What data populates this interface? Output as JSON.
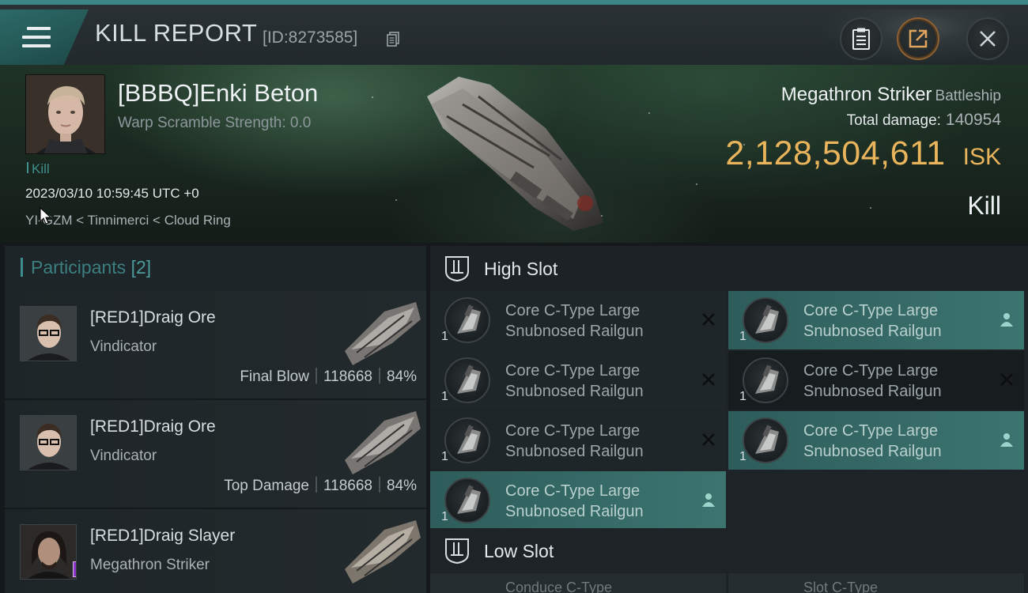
{
  "header": {
    "title": "KILL REPORT",
    "report_id": "[ID:8273585]",
    "icons": [
      "menu-icon",
      "copy-icon",
      "clipboard-icon",
      "share-icon",
      "close-icon"
    ]
  },
  "victim": {
    "name": "[BBBQ]Enki Beton",
    "warp_scramble": "Warp Scramble Strength: 0.0",
    "kill_tag": "Kill",
    "datetime": "2023/03/10 10:59:45 UTC +0",
    "location": "YI-GZM < Tinnimerci < Cloud Ring",
    "ship_name": "Megathron Striker",
    "ship_class": "Battleship",
    "total_damage_label": "Total damage:",
    "total_damage": "140954",
    "isk_value": "2,128,504,611",
    "isk_unit": "ISK",
    "result": "Kill"
  },
  "participants": {
    "label": "Participants",
    "count": "[2]",
    "rows": [
      {
        "name": "[RED1]Draig Ore",
        "ship": "Vindicator",
        "role": "Final Blow",
        "damage": "118668",
        "percent": "84%"
      },
      {
        "name": "[RED1]Draig Ore",
        "ship": "Vindicator",
        "role": "Top Damage",
        "damage": "118668",
        "percent": "84%"
      },
      {
        "name": "[RED1]Draig Slayer",
        "ship": "Megathron Striker",
        "role": "",
        "damage": "",
        "percent": ""
      }
    ]
  },
  "high_slot": {
    "label": "High Slot",
    "modules": [
      {
        "line1": "Core C-Type Large",
        "line2": "Snubnosed Railgun",
        "qty": "1",
        "state": "destroyed"
      },
      {
        "line1": "Core C-Type Large",
        "line2": "Snubnosed Railgun",
        "qty": "1",
        "state": "dropped"
      },
      {
        "line1": "Core C-Type Large",
        "line2": "Snubnosed Railgun",
        "qty": "1",
        "state": "destroyed"
      },
      {
        "line1": "Core C-Type Large",
        "line2": "Snubnosed Railgun",
        "qty": "1",
        "state": "destroyed"
      },
      {
        "line1": "Core C-Type Large",
        "line2": "Snubnosed Railgun",
        "qty": "1",
        "state": "destroyed"
      },
      {
        "line1": "Core C-Type Large",
        "line2": "Snubnosed Railgun",
        "qty": "1",
        "state": "dropped"
      },
      {
        "line1": "Core C-Type Large",
        "line2": "Snubnosed Railgun",
        "qty": "1",
        "state": "dropped"
      }
    ]
  },
  "low_slot": {
    "label": "Low Slot",
    "peek": [
      "Conduce C-Type",
      "Slot C-Type"
    ]
  },
  "colors": {
    "accent": "#3c8d8d",
    "isk": "#e9b45c",
    "dropped_bg": "#3c7470"
  }
}
